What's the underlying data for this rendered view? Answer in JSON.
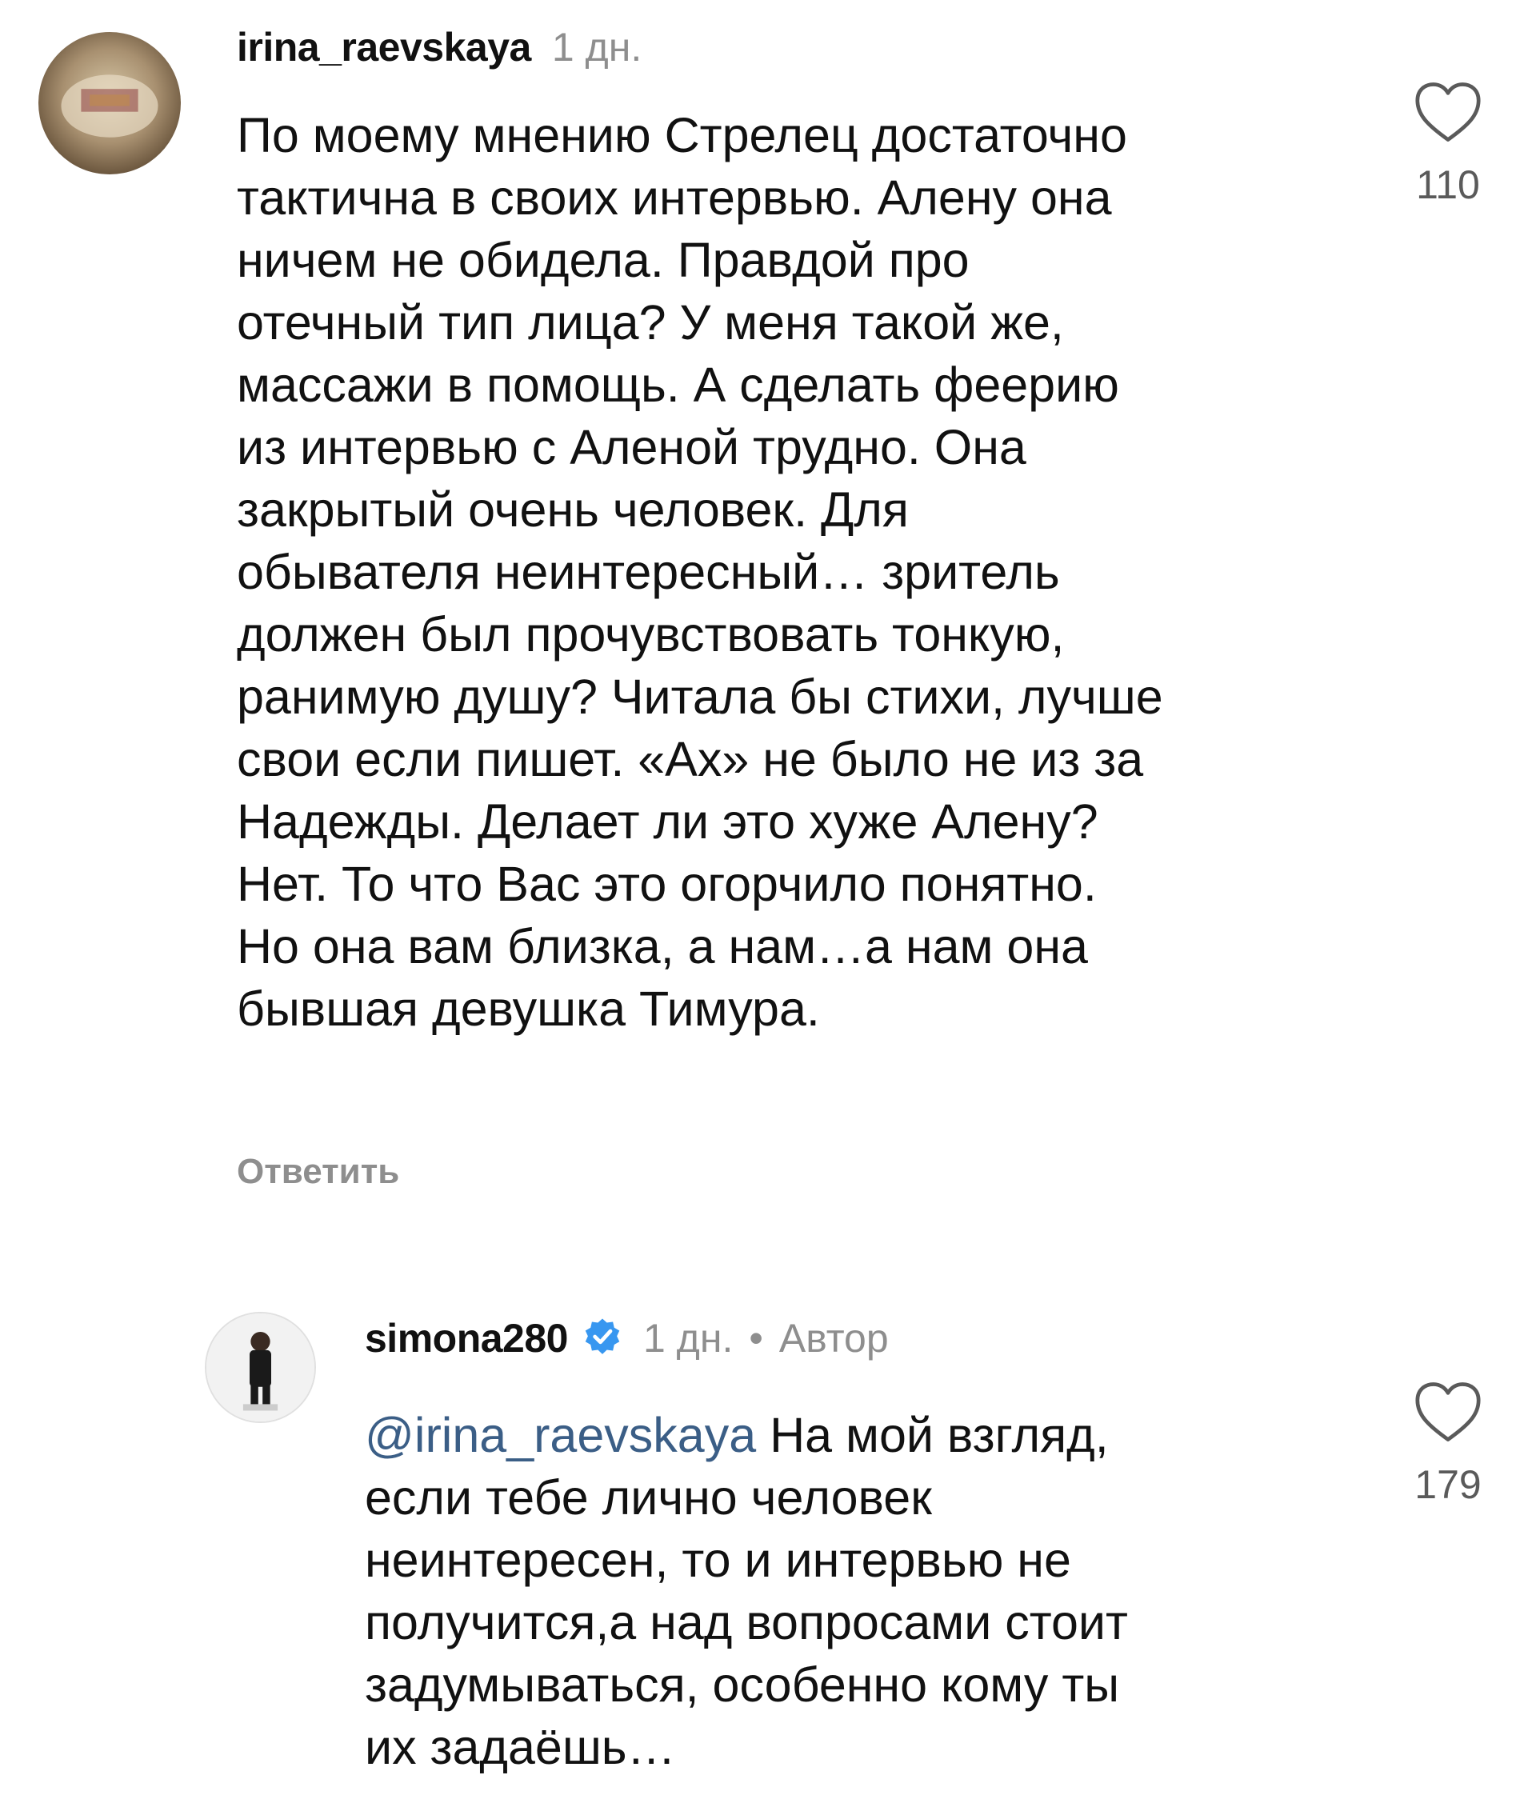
{
  "comments": [
    {
      "username": "irina_raevskaya",
      "time": "1 дн.",
      "lines": [
        "По моему мнению Стрелец достаточно",
        "тактична в своих интервью. Алену она",
        "ничем не обидела. Правдой про",
        "отечный тип лица? У меня такой же,",
        "массажи в помощь. А сделать феерию",
        "из интервью с Аленой трудно. Она",
        "закрытый очень человек. Для",
        "обывателя неинтересный… зритель",
        "должен был прочувствовать тонкую,",
        "ранимую душу? Читала бы стихи, лучше",
        "свои если пишет. «Ах» не было не из за",
        "Надежды. Делает ли это хуже Алену?",
        "Нет. То что Вас это огорчило понятно.",
        "Но она вам близка, а нам…а нам она",
        "бывшая девушка Тимура."
      ],
      "reply_label": "Ответить",
      "likes": "110",
      "icon": "heart-outline-icon"
    },
    {
      "username": "simona280",
      "verified_icon": "verified-badge-icon",
      "time": "1 дн.",
      "separator": "•",
      "author_label": "Автор",
      "mention": "@irina_raevskaya",
      "first_line_rest": " На мой взгляд,",
      "lines": [
        "если тебе лично человек",
        "неинтересен, то и интервью не",
        "получится,а над вопросами стоит",
        "задумываться, особенно кому ты",
        "их задаёшь…"
      ],
      "likes": "179",
      "icon": "heart-outline-icon"
    }
  ],
  "colors": {
    "text": "#111111",
    "muted": "#8e8e8e",
    "mention": "#3b5e86",
    "verified": "#3897f0"
  }
}
